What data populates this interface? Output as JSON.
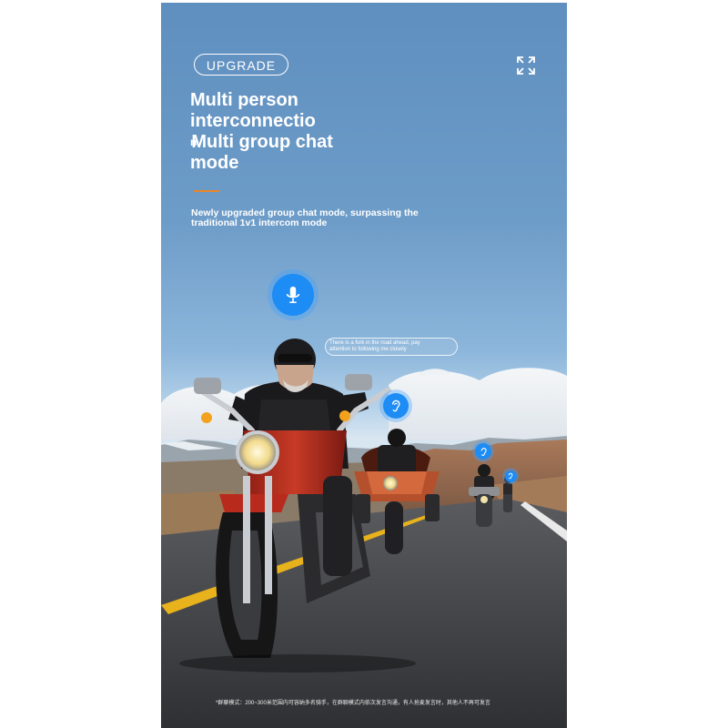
{
  "badge": {
    "label": "UPGRADE"
  },
  "icons": {
    "expand": "expand-icon",
    "mic": "microphone-icon",
    "ear": "ear-icon"
  },
  "headline": {
    "line1": "Multi person",
    "line2": "interconnectio",
    "line3": "n",
    "line4": "Multi group chat",
    "line5": "mode"
  },
  "subtitle": {
    "line1": "Newly upgraded group chat mode, surpassing the",
    "line2": "traditional 1v1 intercom mode"
  },
  "speech_bubble": {
    "line1": "There is a fork in the road ahead, pay",
    "line2": "attention to following me closely"
  },
  "footnote": "*群聊模式：200~300米范围内可容纳多名骑手，在群聊模式内依次发言沟通，有人抢麦发言时，其他人不再可发言",
  "colors": {
    "accent_blue": "#1d8cf5",
    "divider_orange": "#e8862a",
    "sky_top": "#5f8fbf"
  }
}
